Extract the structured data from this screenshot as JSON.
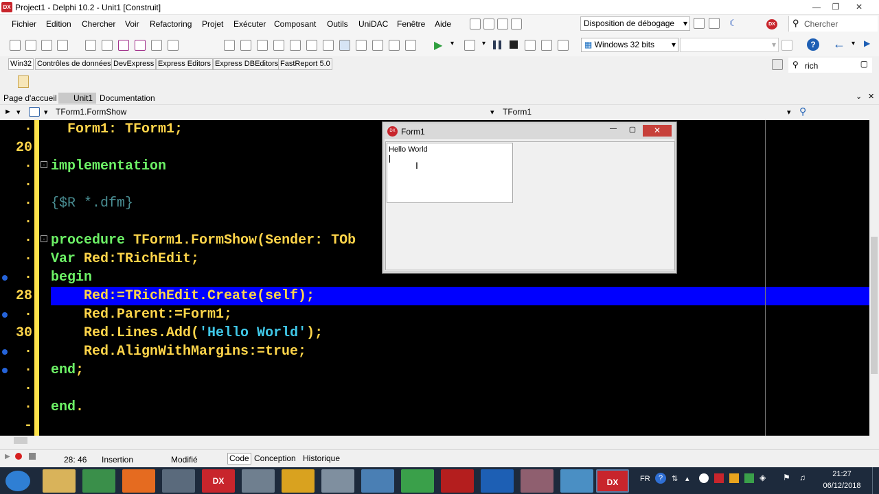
{
  "titlebar": {
    "title": "Project1 - Delphi 10.2 - Unit1 [Construit]",
    "icon": "DX"
  },
  "menu": [
    "Fichier",
    "Edition",
    "Chercher",
    "Voir",
    "Refactoring",
    "Projet",
    "Exécuter",
    "Composant",
    "Outils",
    "UniDAC",
    "Fenêtre",
    "Aide"
  ],
  "toolbar": {
    "layout": "Disposition de débogage",
    "search_placeholder": "Chercher",
    "platform": "Windows 32 bits",
    "platform_config": ""
  },
  "palette": {
    "tabs": [
      "Win32",
      "Contrôles de données",
      "DevExpress",
      "Express Editors",
      "Express DBEditors",
      "FastReport 5.0"
    ],
    "search": "rich"
  },
  "doc_tabs": [
    "Page d'accueil",
    "Unit1",
    "Documentation"
  ],
  "nav": {
    "method": "TForm1.FormShow",
    "class": "TForm1"
  },
  "code": {
    "line_numbers": [
      "·",
      "20",
      "·",
      "·",
      "·",
      "·",
      "·",
      "·",
      "·",
      "28",
      "·",
      "30",
      "·",
      "·",
      "·",
      "·",
      "-"
    ],
    "lines": [
      {
        "p": [
          "  Form1: TForm1;"
        ],
        "c": [
          "id"
        ]
      },
      {
        "p": [
          ""
        ],
        "c": [
          "id"
        ]
      },
      {
        "p": [
          "implementation"
        ],
        "c": [
          "kw"
        ]
      },
      {
        "p": [
          ""
        ],
        "c": [
          "id"
        ]
      },
      {
        "p": [
          "{$R *.dfm}"
        ],
        "c": [
          "cm"
        ]
      },
      {
        "p": [
          ""
        ],
        "c": [
          "id"
        ]
      },
      {
        "p": [
          "procedure",
          " TForm1.FormShow(Sender: TOb"
        ],
        "c": [
          "kw",
          "id"
        ]
      },
      {
        "p": [
          "Var",
          " Red:TRichEdit;"
        ],
        "c": [
          "kw",
          "id"
        ]
      },
      {
        "p": [
          "begin"
        ],
        "c": [
          "kw"
        ]
      },
      {
        "p": [
          "    Red:=TRichEdit.Create(self);"
        ],
        "c": [
          "id"
        ]
      },
      {
        "p": [
          "    Red.Parent:=Form1;"
        ],
        "c": [
          "id"
        ]
      },
      {
        "p": [
          "    Red.Lines.Add(",
          "'Hello World'",
          ");"
        ],
        "c": [
          "id",
          "str",
          "id"
        ]
      },
      {
        "p": [
          "    Red.AlignWithMargins:=true;"
        ],
        "c": [
          "id"
        ]
      },
      {
        "p": [
          "end",
          ";"
        ],
        "c": [
          "kw",
          "id"
        ]
      },
      {
        "p": [
          ""
        ],
        "c": [
          "id"
        ]
      },
      {
        "p": [
          "end",
          "."
        ],
        "c": [
          "kw",
          "id"
        ]
      }
    ]
  },
  "form1": {
    "title": "Form1",
    "richedit_text": "Hello World"
  },
  "status": {
    "position": "28: 46",
    "mode": "Insertion",
    "state": "Modifié",
    "tabs": [
      "Code",
      "Conception",
      "Historique"
    ]
  },
  "taskbar": {
    "lang": "FR",
    "time": "21:27",
    "date": "06/12/2018"
  },
  "colors": {
    "highlight": "#0000ff",
    "keyword": "#6df266",
    "ident": "#ffd54a",
    "comment": "#4a8f94",
    "string": "#40c8e8"
  }
}
